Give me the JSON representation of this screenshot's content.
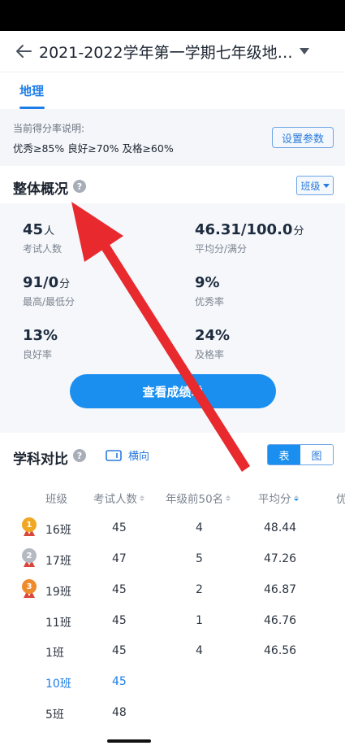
{
  "header": {
    "title": "2021-2022学年第一学期七年级地…"
  },
  "subject_tab": {
    "label": "地理"
  },
  "rate_info": {
    "label": "当前得分率说明:",
    "values": "优秀≥85% 良好≥70% 及格≥60%",
    "settings_button": "设置参数"
  },
  "overview": {
    "title": "整体概况",
    "help_glyph": "?",
    "scope_select": "班级",
    "metrics": [
      {
        "value": "45",
        "unit": "人",
        "label": "考试人数"
      },
      {
        "value": "46.31/100.0",
        "unit": "分",
        "label": "平均分/满分"
      },
      {
        "value": "91/0",
        "unit": "分",
        "label": "最高/最低分"
      },
      {
        "value": "9%",
        "unit": "",
        "label": "优秀率"
      },
      {
        "value": "13%",
        "unit": "",
        "label": "良好率"
      },
      {
        "value": "24%",
        "unit": "",
        "label": "及格率"
      }
    ],
    "view_button": "查看成绩单"
  },
  "comparison": {
    "title": "学科对比",
    "help_glyph": "?",
    "landscape_label": "横向",
    "toggle_table": "表",
    "toggle_chart": "图",
    "columns": [
      "班级",
      "考试人数",
      "年级前50名",
      "平均分",
      "优"
    ],
    "rows": [
      {
        "medal": "1",
        "class": "16班",
        "count": "45",
        "top50": "4",
        "avg": "48.44",
        "highlight": false
      },
      {
        "medal": "2",
        "class": "17班",
        "count": "47",
        "top50": "5",
        "avg": "47.26",
        "highlight": false
      },
      {
        "medal": "3",
        "class": "19班",
        "count": "45",
        "top50": "2",
        "avg": "46.87",
        "highlight": false
      },
      {
        "medal": "",
        "class": "11班",
        "count": "45",
        "top50": "1",
        "avg": "46.76",
        "highlight": false
      },
      {
        "medal": "",
        "class": "1班",
        "count": "45",
        "top50": "4",
        "avg": "46.56",
        "highlight": false
      },
      {
        "medal": "",
        "class": "10班",
        "count": "45",
        "top50": "",
        "avg": "",
        "highlight": true
      },
      {
        "medal": "",
        "class": "5班",
        "count": "48",
        "top50": "",
        "avg": "",
        "highlight": false
      }
    ]
  },
  "colors": {
    "accent": "#1a8ff0",
    "link": "#1e7ee8",
    "gold": "#f0a824",
    "silver": "#b5bac2",
    "bronze": "#ee8b2a",
    "annotation": "#e8292e"
  }
}
